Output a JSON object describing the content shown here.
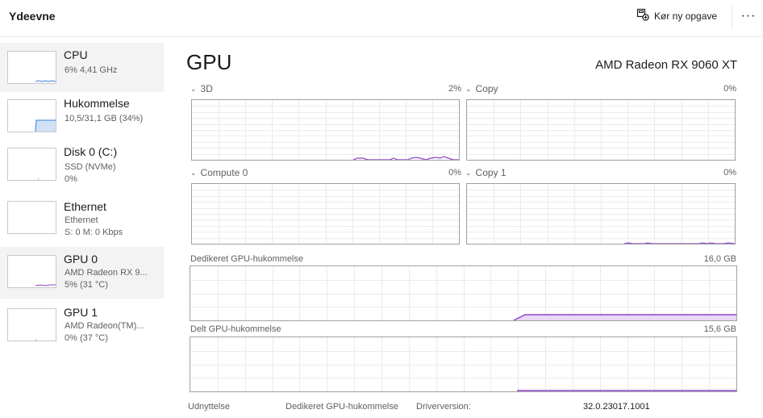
{
  "header": {
    "title": "Ydeevne",
    "run_task_label": "Kør ny opgave",
    "more_label": "···"
  },
  "sidebar": {
    "items": [
      {
        "name": "CPU",
        "sub1": "6% 4,41 GHz",
        "sub2": ""
      },
      {
        "name": "Hukommelse",
        "sub1": "10,5/31,1 GB (34%)",
        "sub2": ""
      },
      {
        "name": "Disk 0 (C:)",
        "sub1": "SSD (NVMe)",
        "sub2": "0%"
      },
      {
        "name": "Ethernet",
        "sub1": "Ethernet",
        "sub2": "S: 0 M: 0 Kbps"
      },
      {
        "name": "GPU 0",
        "sub1": "AMD Radeon RX 9...",
        "sub2": "5% (31 °C)"
      },
      {
        "name": "GPU 1",
        "sub1": "AMD Radeon(TM)...",
        "sub2": "0% (37 °C)"
      }
    ]
  },
  "main": {
    "title": "GPU",
    "model": "AMD Radeon RX 9060 XT",
    "engines": [
      {
        "label": "3D",
        "percent": "2%"
      },
      {
        "label": "Copy",
        "percent": "0%"
      },
      {
        "label": "Compute 0",
        "percent": "0%"
      },
      {
        "label": "Copy 1",
        "percent": "0%"
      }
    ],
    "dedicated_memory": {
      "label": "Dedikeret GPU-hukommelse",
      "max": "16,0 GB"
    },
    "shared_memory": {
      "label": "Delt GPU-hukommelse",
      "max": "15,6 GB"
    },
    "stats": {
      "utilization_label": "Udnyttelse",
      "dedicated_label": "Dedikeret GPU-hukommelse",
      "driver_version_label": "Driverversion:",
      "driver_version_value": "32.0.23017.1001"
    }
  },
  "colors": {
    "gpu_line": "#8e44c9",
    "gpu_fill": "#e9d8f5",
    "memory_line": "#3b7dd8",
    "memory_fill": "#cfe2f7",
    "disk_line": "#4a9a3a",
    "grid": "#ebebeb"
  }
}
